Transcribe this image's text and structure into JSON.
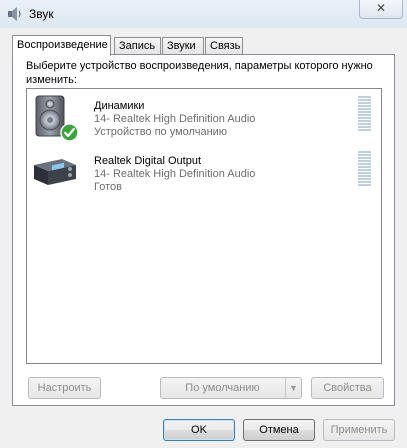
{
  "window": {
    "title": "Звук",
    "close_symbol": "✕"
  },
  "tabs": [
    {
      "label": "Воспроизведение",
      "active": true
    },
    {
      "label": "Запись",
      "active": false
    },
    {
      "label": "Звуки",
      "active": false
    },
    {
      "label": "Связь",
      "active": false
    }
  ],
  "playback": {
    "instruction": "Выберите устройство воспроизведения, параметры которого нужно изменить:",
    "devices": [
      {
        "name": "Динамики",
        "driver": "14- Realtek High Definition Audio",
        "status": "Устройство по умолчанию",
        "is_default": true,
        "icon": "speaker-icon"
      },
      {
        "name": "Realtek Digital Output",
        "driver": "14- Realtek High Definition Audio",
        "status": "Готов",
        "is_default": false,
        "icon": "digital-output-icon"
      }
    ],
    "configure_label": "Настроить",
    "set_default_label": "По умолчанию",
    "properties_label": "Свойства"
  },
  "footer": {
    "ok_label": "OK",
    "cancel_label": "Отмена",
    "apply_label": "Применить"
  },
  "colors": {
    "default_check": "#3aa53a",
    "meter": "#bcd0de"
  }
}
